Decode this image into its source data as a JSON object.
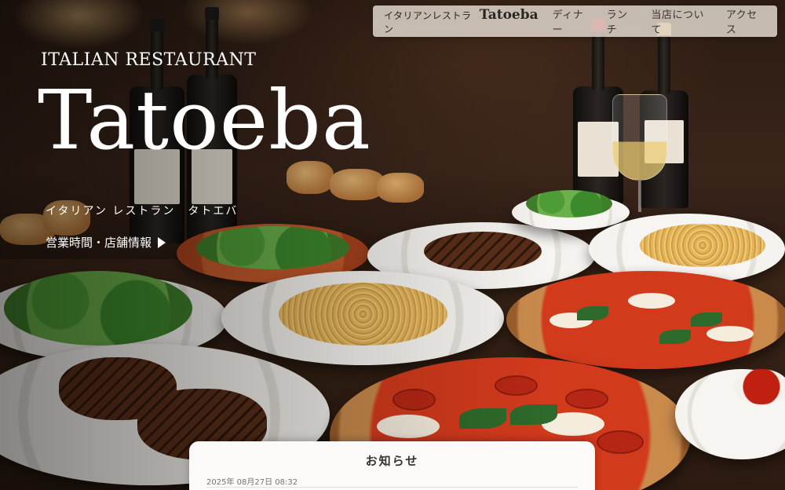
{
  "nav": {
    "brand_jp": "イタリアンレストラン",
    "brand_en": "Tatoeba",
    "links": [
      "ディナー",
      "ランチ",
      "当店について",
      "アクセス"
    ]
  },
  "hero": {
    "subtitle": "ITALIAN RESTAURANT",
    "title": "Tatoeba",
    "kana": "イタリアン レストラン　タトエバ",
    "info_link": "営業時間・店舗情報"
  },
  "notice": {
    "heading": "お知らせ",
    "date": "2025年 08月27日 08:32"
  },
  "colors": {
    "nav_bg": "#e6ded4",
    "hero_text": "#ffffff",
    "notice_bg": "#fbfaf8"
  }
}
